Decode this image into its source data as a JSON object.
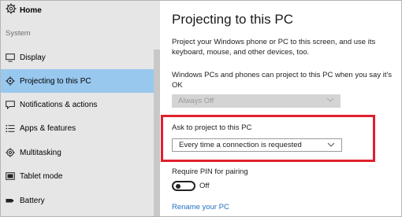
{
  "sidebar": {
    "home_label": "Home",
    "section_label": "System",
    "items": [
      {
        "label": "Display",
        "icon": "monitor-icon"
      },
      {
        "label": "Projecting to this PC",
        "icon": "project-icon",
        "active": true
      },
      {
        "label": "Notifications & actions",
        "icon": "notifications-icon"
      },
      {
        "label": "Apps & features",
        "icon": "apps-list-icon"
      },
      {
        "label": "Multitasking",
        "icon": "multitasking-icon"
      },
      {
        "label": "Tablet mode",
        "icon": "tablet-icon"
      },
      {
        "label": "Battery",
        "icon": "battery-icon"
      }
    ]
  },
  "main": {
    "title": "Projecting to this PC",
    "description": "Project your Windows phone or PC to this screen, and use its keyboard, mouse, and other devices, too.",
    "availability_label": "Windows PCs and phones can project to this PC when you say it's OK",
    "availability_value": "Always Off",
    "ask_label": "Ask to project to this PC",
    "ask_value": "Every time a connection is requested",
    "pin_label": "Require PIN for pairing",
    "pin_state": "Off",
    "rename_link": "Rename your PC"
  },
  "colors": {
    "sidebar_bg": "#e6e6e6",
    "active_item_bg": "#99c8ef",
    "highlight_border": "#e0202c",
    "link": "#1f6fc4"
  }
}
